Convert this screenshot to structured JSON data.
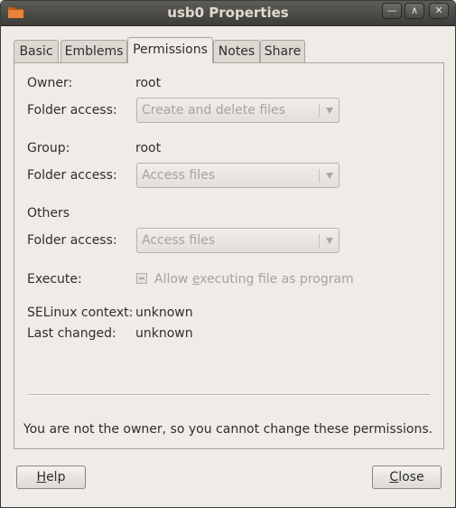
{
  "window": {
    "title": "usb0 Properties"
  },
  "tabs": [
    "Basic",
    "Emblems",
    "Permissions",
    "Notes",
    "Share"
  ],
  "permissions": {
    "owner_label": "Owner:",
    "owner_value": "root",
    "owner_access_label": "Folder access:",
    "owner_access_value": "Create and delete files",
    "group_label": "Group:",
    "group_value": "root",
    "group_access_label": "Folder access:",
    "group_access_value": "Access files",
    "others_label": "Others",
    "others_access_label": "Folder access:",
    "others_access_value": "Access files",
    "execute_label": "Execute:",
    "execute_option_pre": "Allow ",
    "execute_option_mnemonic": "e",
    "execute_option_post": "xecuting file as program",
    "selinux_label": "SELinux context:",
    "selinux_value": "unknown",
    "last_changed_label": "Last changed:",
    "last_changed_value": "unknown",
    "notice": "You are not the owner, so you cannot change these permissions."
  },
  "buttons": {
    "help_mnemonic": "H",
    "help_rest": "elp",
    "close_mnemonic": "C",
    "close_rest": "lose"
  },
  "icons": {
    "window": "folder-icon",
    "minimize": "minimize-icon",
    "maximize": "maximize-icon",
    "close": "close-icon"
  }
}
